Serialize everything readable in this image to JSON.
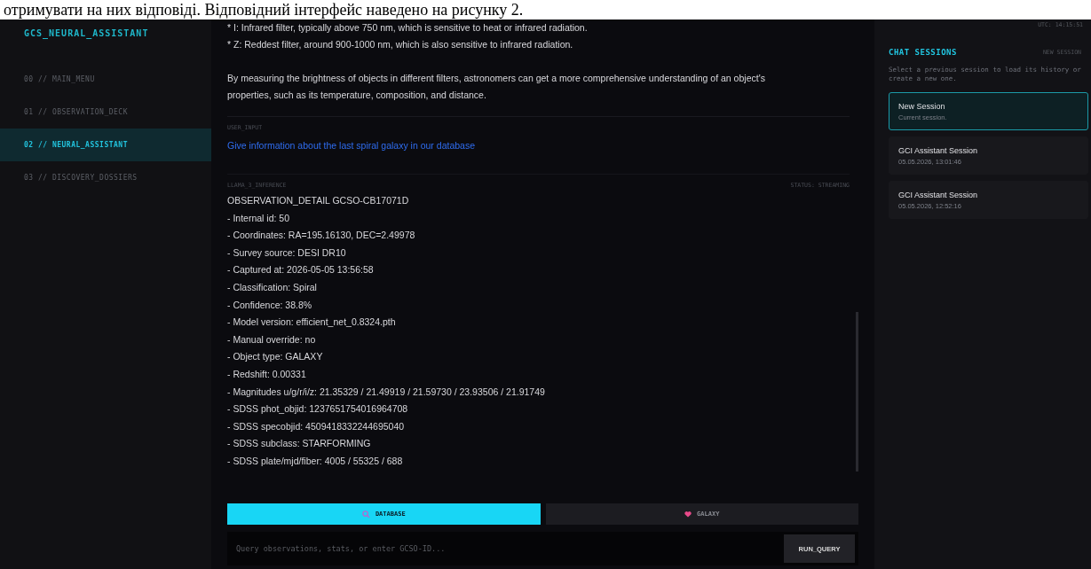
{
  "document_text": "отримувати на них відповіді. Відповідний інтерфейс наведено на рисунку 2.",
  "sidebar": {
    "title": "GCS_NEURAL_ASSISTANT",
    "items": [
      {
        "label": "00 // MAIN_MENU",
        "selected": false
      },
      {
        "label": "01 // OBSERVATION_DECK",
        "selected": false
      },
      {
        "label": "02 // NEURAL_ASSISTANT",
        "selected": true
      },
      {
        "label": "03 // DISCOVERY_DOSSIERS",
        "selected": false
      }
    ]
  },
  "chat": {
    "previous_lines": [
      "* I: Infrared filter, typically above 750 nm, which is sensitive to heat or infrared radiation.",
      "* Z: Reddest filter, around 900-1000 nm, which is also sensitive to infrared radiation."
    ],
    "previous_paragraph": "By measuring the brightness of objects in different filters, astronomers can get a more comprehensive understanding of an object's properties, such as its temperature, composition, and distance.",
    "user_label": "USER_INPUT",
    "user_message": "Give information about the last spiral galaxy in our database",
    "ai_label": "LLAMA_3_INFERENCE",
    "status": "STATUS: STREAMING",
    "response_lines": [
      "OBSERVATION_DETAIL GCSO-CB17071D",
      "- Internal id: 50",
      "- Coordinates: RA=195.16130, DEC=2.49978",
      "- Survey source: DESI DR10",
      "- Captured at: 2026-05-05 13:56:58",
      "- Classification: Spiral",
      "- Confidence: 38.8%",
      "- Model version: efficient_net_0.8324.pth",
      "- Manual override: no",
      "- Object type: GALAXY",
      "- Redshift: 0.00331",
      "- Magnitudes u/g/r/i/z: 21.35329 / 21.49919 / 21.59730 / 23.93506 / 21.91749",
      "- SDSS phot_objid: 1237651754016964708",
      "- SDSS specobjid: 4509418332244695040",
      "- SDSS subclass: STARFORMING",
      "- SDSS plate/mjd/fiber: 4005 / 55325 / 688"
    ]
  },
  "modes": [
    {
      "label": "DATABASE",
      "selected": true,
      "kind": "search"
    },
    {
      "label": "GALAXY",
      "selected": false,
      "kind": "heart"
    }
  ],
  "query": {
    "placeholder": "Query observations, stats, or enter GCSO-ID...",
    "button": "RUN_QUERY"
  },
  "clock": "UTC: 14:15:51",
  "sessions_panel": {
    "title": "CHAT SESSIONS",
    "new_button": "NEW SESSION",
    "hint": "Select a previous session to load its history or create a new one.",
    "sessions": [
      {
        "title": "New Session",
        "subtitle": "Current session.",
        "selected": true
      },
      {
        "title": "GCI Assistant Session",
        "subtitle": "05.05.2026, 13:01:46",
        "selected": false
      },
      {
        "title": "GCI Assistant Session",
        "subtitle": "05.05.2026, 12:52:16",
        "selected": false
      }
    ]
  }
}
